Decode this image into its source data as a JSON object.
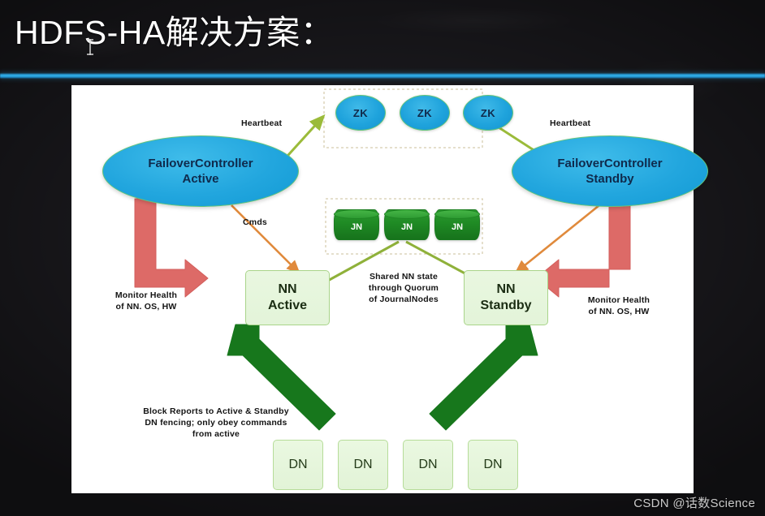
{
  "slide": {
    "title": "HDFS-HA解决方案：",
    "watermark": "CSDN @话数Science"
  },
  "colors": {
    "accent_line": "#2aa8e8",
    "zk_fill": "#1fa3dc",
    "fc_fill": "#22a6de",
    "jn_fill": "#1f8a24",
    "nn_fill": "#e6f5dd",
    "dn_fill": "#e8f7df",
    "monitor_arrow": "#d9605e",
    "cmds_arrow": "#e08a3c",
    "heartbeat_arrow": "#9bbb3a",
    "block_report_arrow": "#17771c",
    "panel_bg": "#ffffff"
  },
  "diagram": {
    "zk_nodes": [
      {
        "label": "ZK"
      },
      {
        "label": "ZK"
      },
      {
        "label": "ZK"
      }
    ],
    "jn_nodes": [
      {
        "label": "JN"
      },
      {
        "label": "JN"
      },
      {
        "label": "JN"
      }
    ],
    "failover_controllers": [
      {
        "line1": "FailoverController",
        "line2": "Active"
      },
      {
        "line1": "FailoverController",
        "line2": "Standby"
      }
    ],
    "namenodes": [
      {
        "line1": "NN",
        "line2": "Active"
      },
      {
        "line1": "NN",
        "line2": "Standby"
      }
    ],
    "datanodes": [
      {
        "label": "DN"
      },
      {
        "label": "DN"
      },
      {
        "label": "DN"
      },
      {
        "label": "DN"
      }
    ],
    "labels": {
      "heartbeat_left": "Heartbeat",
      "heartbeat_right": "Heartbeat",
      "cmds": "Cmds",
      "monitor_left": "Monitor Health\nof NN. OS, HW",
      "monitor_left_l1": "Monitor Health",
      "monitor_left_l2": "of NN. OS, HW",
      "monitor_right_l1": "Monitor Health",
      "monitor_right_l2": "of NN. OS, HW",
      "shared_state_l1": "Shared NN state",
      "shared_state_l2": "through Quorum",
      "shared_state_l3": "of JournalNodes",
      "block_report_l1": "Block Reports to Active & Standby",
      "block_report_l2": "DN fencing; only obey commands",
      "block_report_l3": "from active"
    }
  }
}
